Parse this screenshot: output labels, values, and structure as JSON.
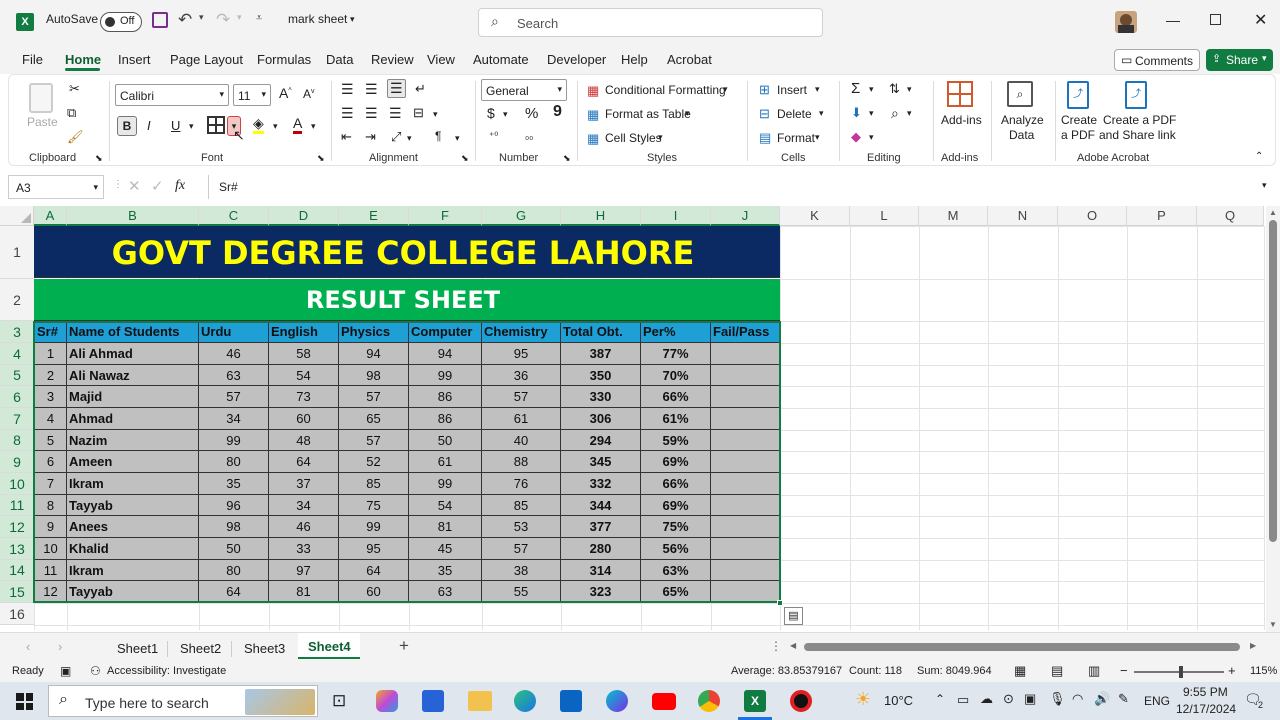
{
  "titlebar": {
    "autosave_label": "AutoSave",
    "autosave_state": "Off",
    "filename": "mark sheet",
    "search_placeholder": "Search"
  },
  "menu": [
    "File",
    "Home",
    "Insert",
    "Page Layout",
    "Formulas",
    "Data",
    "Review",
    "View",
    "Automate",
    "Developer",
    "Help",
    "Acrobat"
  ],
  "menu_active": "Home",
  "actions": {
    "comments": "Comments",
    "share": "Share"
  },
  "ribbon": {
    "clipboard": {
      "paste": "Paste",
      "label": "Clipboard"
    },
    "font": {
      "name": "Calibri",
      "size": "11",
      "bold": "B",
      "italic": "I",
      "underline": "U",
      "label": "Font"
    },
    "alignment": {
      "label": "Alignment"
    },
    "number": {
      "format": "General",
      "label": "Number"
    },
    "styles": {
      "cond": "Conditional Formatting",
      "table": "Format as Table",
      "cell": "Cell Styles",
      "label": "Styles"
    },
    "cells": {
      "insert": "Insert",
      "delete": "Delete",
      "format": "Format",
      "label": "Cells"
    },
    "editing": {
      "label": "Editing"
    },
    "addins": {
      "btn": "Add-ins",
      "label": "Add-ins"
    },
    "analyze": {
      "line1": "Analyze",
      "line2": "Data"
    },
    "acrobat": {
      "pdf1": "Create",
      "pdf2": "a PDF",
      "share1": "Create a PDF",
      "share2": "and Share link",
      "label": "Adobe Acrobat"
    }
  },
  "formula": {
    "namebox": "A3",
    "fx": "fx",
    "content": "Sr#"
  },
  "columns": [
    "A",
    "B",
    "C",
    "D",
    "E",
    "F",
    "G",
    "H",
    "I",
    "J",
    "K",
    "L",
    "M",
    "N",
    "O",
    "P",
    "Q"
  ],
  "rows": [
    "1",
    "2",
    "3",
    "4",
    "5",
    "6",
    "7",
    "8",
    "9",
    "10",
    "11",
    "12",
    "13",
    "14",
    "15",
    "16"
  ],
  "sheet": {
    "title": "GOVT DEGREE COLLEGE LAHORE",
    "subtitle": "RESULT SHEET",
    "headers": [
      "Sr#",
      "Name of Students",
      "Urdu",
      "English",
      "Physics",
      "Computer",
      "Chemistry",
      "Total Obt.",
      "Per%",
      "Fail/Pass"
    ],
    "data": [
      [
        "1",
        "Ali Ahmad",
        "46",
        "58",
        "94",
        "94",
        "95",
        "387",
        "77%",
        ""
      ],
      [
        "2",
        "Ali Nawaz",
        "63",
        "54",
        "98",
        "99",
        "36",
        "350",
        "70%",
        ""
      ],
      [
        "3",
        "Majid",
        "57",
        "73",
        "57",
        "86",
        "57",
        "330",
        "66%",
        ""
      ],
      [
        "4",
        "Ahmad",
        "34",
        "60",
        "65",
        "86",
        "61",
        "306",
        "61%",
        ""
      ],
      [
        "5",
        "Nazim",
        "99",
        "48",
        "57",
        "50",
        "40",
        "294",
        "59%",
        ""
      ],
      [
        "6",
        "Ameen",
        "80",
        "64",
        "52",
        "61",
        "88",
        "345",
        "69%",
        ""
      ],
      [
        "7",
        "Ikram",
        "35",
        "37",
        "85",
        "99",
        "76",
        "332",
        "66%",
        ""
      ],
      [
        "8",
        "Tayyab",
        "96",
        "34",
        "75",
        "54",
        "85",
        "344",
        "69%",
        ""
      ],
      [
        "9",
        "Anees",
        "98",
        "46",
        "99",
        "81",
        "53",
        "377",
        "75%",
        ""
      ],
      [
        "10",
        "Khalid",
        "50",
        "33",
        "95",
        "45",
        "57",
        "280",
        "56%",
        ""
      ],
      [
        "11",
        "Ikram",
        "80",
        "97",
        "64",
        "35",
        "38",
        "314",
        "63%",
        ""
      ],
      [
        "12",
        "Tayyab",
        "64",
        "81",
        "60",
        "63",
        "55",
        "323",
        "65%",
        ""
      ]
    ]
  },
  "tabs": [
    "Sheet1",
    "Sheet2",
    "Sheet3",
    "Sheet4"
  ],
  "active_tab": "Sheet4",
  "status": {
    "ready": "Ready",
    "accessibility": "Accessibility: Investigate",
    "average": "Average: 83.85379167",
    "count": "Count: 118",
    "sum": "Sum: 8049.964",
    "zoom": "115%"
  },
  "taskbar": {
    "search_placeholder": "Type here to search",
    "weather": "10°C",
    "lang": "ENG",
    "time": "9:55 PM",
    "date": "12/17/2024",
    "notif": "2"
  },
  "colors": {
    "title_bg": "#0b2a63",
    "title_fg": "#ffff00",
    "sub_bg": "#00b050",
    "hdr_bg": "#1e9fd6",
    "data_bg": "#c0c0c0",
    "excel_green": "#107c41"
  }
}
